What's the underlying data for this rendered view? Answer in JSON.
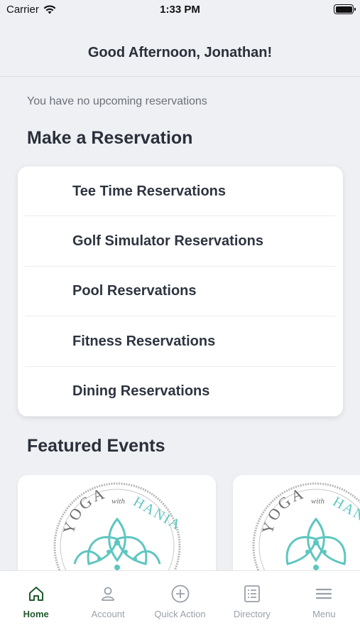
{
  "status": {
    "carrier": "Carrier",
    "time": "1:33 PM"
  },
  "header": {
    "greeting": "Good Afternoon, Jonathan!"
  },
  "reservations": {
    "empty_text": "You have no upcoming reservations",
    "section_title": "Make a Reservation",
    "items": [
      {
        "label": "Tee Time Reservations"
      },
      {
        "label": "Golf Simulator Reservations"
      },
      {
        "label": "Pool Reservations"
      },
      {
        "label": "Fitness Reservations"
      },
      {
        "label": "Dining Reservations"
      }
    ]
  },
  "events": {
    "section_title": "Featured Events",
    "cards": [
      {
        "logo_word1": "YOGA",
        "logo_word2": "with",
        "logo_word3": "HANIA"
      },
      {
        "logo_word1": "YOGA",
        "logo_word2": "with",
        "logo_word3": "HANIA"
      }
    ]
  },
  "tabs": [
    {
      "label": "Home",
      "icon": "home-icon",
      "active": true
    },
    {
      "label": "Account",
      "icon": "person-icon",
      "active": false
    },
    {
      "label": "Quick Action",
      "icon": "plus-circle-icon",
      "active": false
    },
    {
      "label": "Directory",
      "icon": "list-icon",
      "active": false
    },
    {
      "label": "Menu",
      "icon": "hamburger-icon",
      "active": false
    }
  ],
  "colors": {
    "accent": "#1f5a2c",
    "background": "#eff0f3",
    "teal": "#5ec6c0"
  }
}
